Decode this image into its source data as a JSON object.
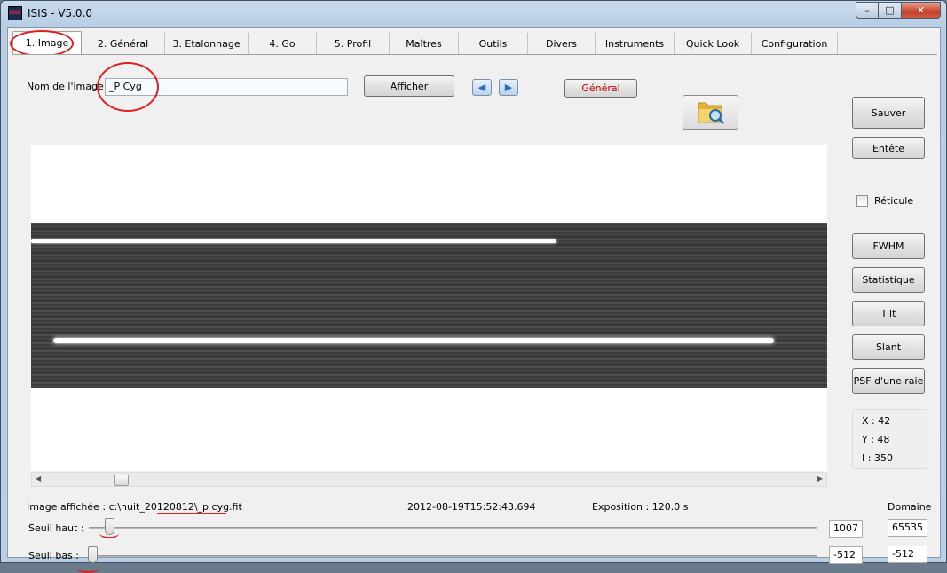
{
  "window": {
    "title": "ISIS - V5.0.0",
    "icon_text": "ISIS",
    "min": "–",
    "max": "□",
    "close": "✕"
  },
  "tabs": [
    "1. Image",
    "2. Général",
    "3. Etalonnage",
    "4. Go",
    "5. Profil",
    "Maîtres",
    "Outils",
    "Divers",
    "Instruments",
    "Quick Look",
    "Configuration"
  ],
  "image_name": {
    "label": "Nom de l'image",
    "value": "_P Cyg"
  },
  "buttons": {
    "afficher": "Afficher",
    "general": "Général",
    "prev": "◀",
    "next": "▶"
  },
  "right_panel": {
    "sauver": "Sauver",
    "entete": "Entête",
    "reticule": "Réticule",
    "fwhm": "FWHM",
    "statistique": "Statistique",
    "tilt": "Tilt",
    "slant": "Slant",
    "psf": "PSF d'une raie"
  },
  "coords": {
    "x": "X : 42",
    "y": "Y : 48",
    "i": "I  : 350"
  },
  "status": {
    "image_affichee": "Image affichée : c:\\nuit_20120812\\_p cyg.fit",
    "date": "2012-08-19T15:52:43.694",
    "exposition": "Exposition : 120.0 s",
    "domaine": "Domaine"
  },
  "seuil": {
    "haut_label": "Seuil haut :",
    "bas_label": "Seuil bas :",
    "haut_value": "1007",
    "bas_value": "-512",
    "haut_domain": "65535",
    "bas_domain": "-512"
  },
  "colors": {
    "accent_red": "#e02020",
    "general_text": "#c00000"
  }
}
